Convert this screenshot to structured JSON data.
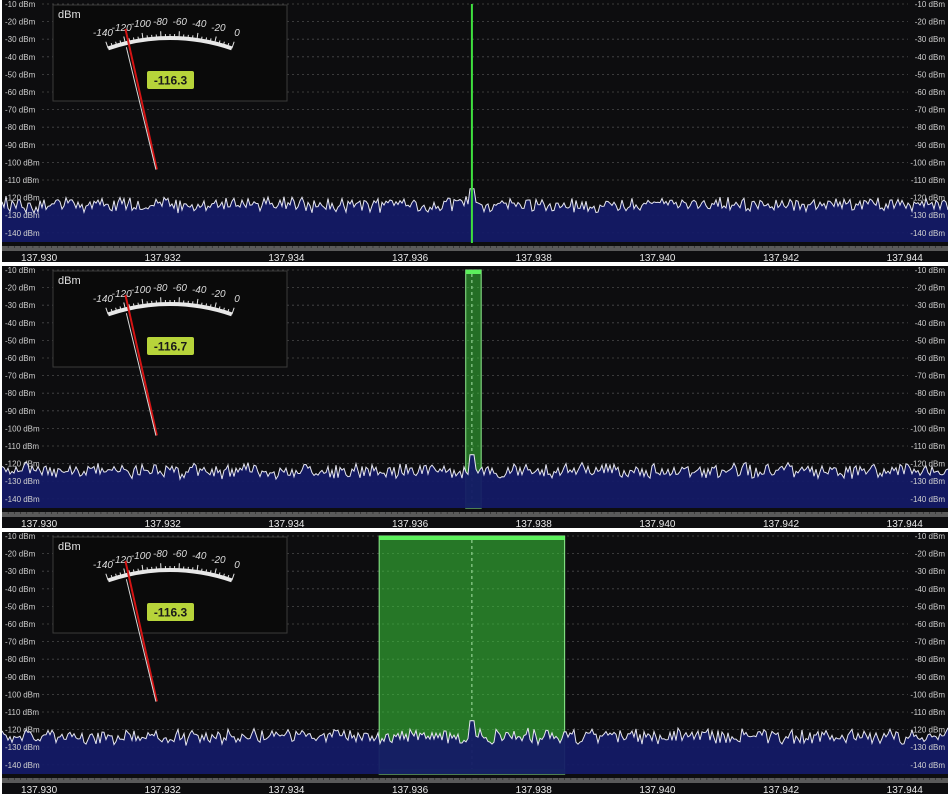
{
  "panels": [
    {
      "meter_value": "-116.3",
      "filter_start_mhz": 137.937,
      "filter_end_mhz": 137.937,
      "style": "line"
    },
    {
      "meter_value": "-116.7",
      "filter_start_mhz": 137.9369,
      "filter_end_mhz": 137.93715,
      "style": "narrow"
    },
    {
      "meter_value": "-116.3",
      "filter_start_mhz": 137.9355,
      "filter_end_mhz": 137.9385,
      "style": "wide"
    }
  ],
  "spectrum": {
    "unit": "dBm",
    "freq_min": 137.9294,
    "freq_max": 137.9447,
    "level_max": -10,
    "level_min": -145,
    "center_freq": 137.937,
    "noise_floor": -124,
    "peak_level": -115,
    "y_ticks": [
      -10,
      -20,
      -30,
      -40,
      -50,
      -60,
      -70,
      -80,
      -90,
      -100,
      -110,
      -120,
      -130,
      -140
    ],
    "y_tick_labels": [
      "-10 dBm",
      "-20 dBm",
      "-30 dBm",
      "-40 dBm",
      "-50 dBm",
      "-60 dBm",
      "-70 dBm",
      "-80 dBm",
      "-90 dBm",
      "-100 dBm",
      "-110 dBm",
      "-120 dBm",
      "-130 dBm",
      "-140 dBm"
    ],
    "x_ticks": [
      137.93,
      137.932,
      137.934,
      137.936,
      137.938,
      137.94,
      137.942,
      137.944
    ],
    "x_tick_labels": [
      "137.930",
      "137.932",
      "137.934",
      "137.936",
      "137.938",
      "137.940",
      "137.942",
      "137.944"
    ]
  },
  "smeter": {
    "unit_label": "dBm",
    "scale_labels": [
      "-140",
      "-120",
      "-100",
      "-80",
      "-60",
      "-40",
      "-20",
      "0"
    ],
    "scale_values": [
      -140,
      -120,
      -100,
      -80,
      -60,
      -40,
      -20,
      0
    ],
    "needle_level": -116.5,
    "peak_level": -120
  },
  "colors": {
    "background": "#0d0d0f",
    "spectrum_fill": "#141a66",
    "spectrum_line": "#e6e6f0",
    "filter_green": "#3ccf3c",
    "meter_badge": "#b7d43a",
    "needle_red": "#d41414",
    "grid": "#4a4a4a"
  }
}
